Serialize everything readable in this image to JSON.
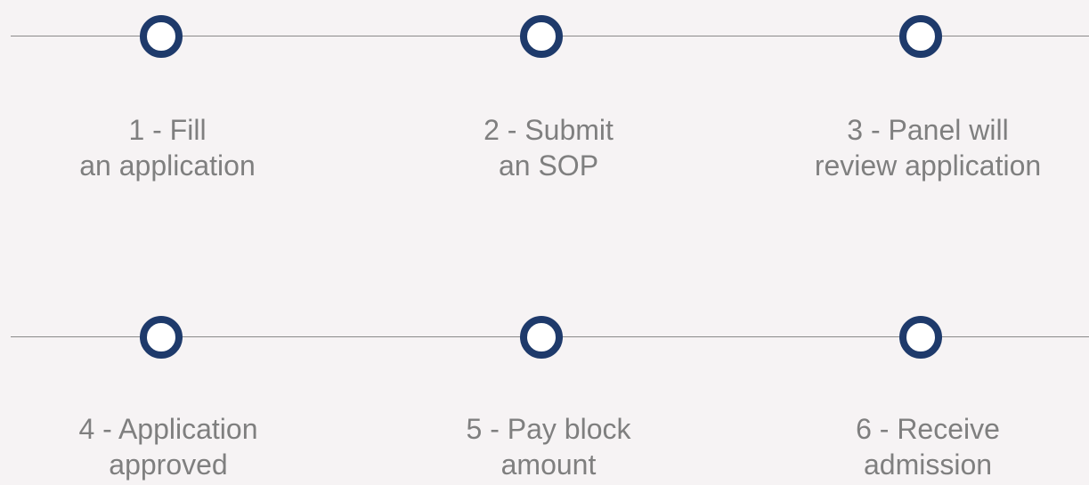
{
  "accent_color": "#1e3a6b",
  "line_color": "#8a8a8a",
  "text_color": "#7f7f7f",
  "background_color": "#f6f3f4",
  "marker_icon": "circle-ring-icon",
  "steps": [
    {
      "line1": "1 - Fill",
      "line2": "an application"
    },
    {
      "line1": "2 - Submit",
      "line2": "an SOP"
    },
    {
      "line1": "3 - Panel will",
      "line2": "review application"
    },
    {
      "line1": "4 - Application",
      "line2": "approved"
    },
    {
      "line1": "5 - Pay block",
      "line2": "amount"
    },
    {
      "line1": "6 - Receive",
      "line2": "admission"
    }
  ]
}
